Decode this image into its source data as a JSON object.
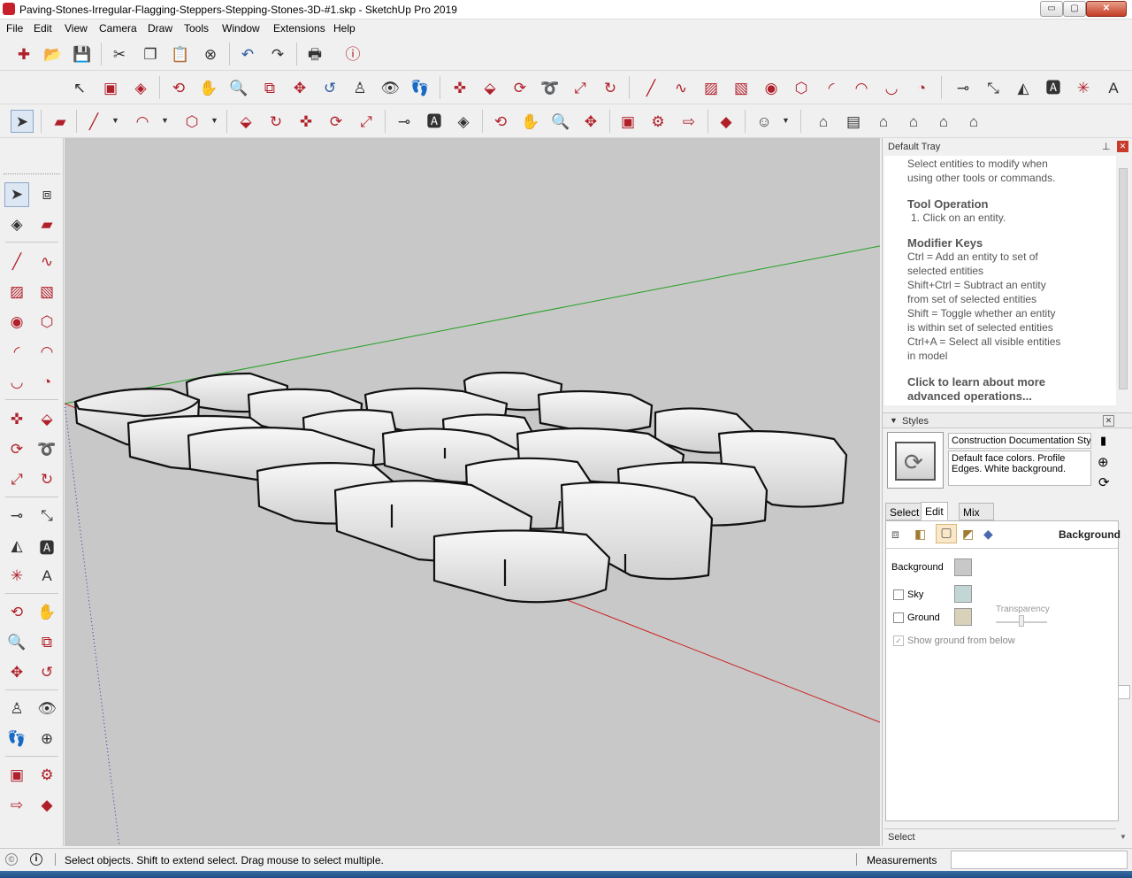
{
  "window": {
    "title": "Paving-Stones-Irregular-Flagging-Steppers-Stepping-Stones-3D-#1.skp - SketchUp Pro 2019",
    "minimize": "▭",
    "maximize": "▢",
    "close": "✕"
  },
  "menu": [
    "File",
    "Edit",
    "View",
    "Camera",
    "Draw",
    "Tools",
    "Window",
    "Extensions",
    "Help"
  ],
  "tray": {
    "title": "Default Tray",
    "pin": "⊥",
    "close": "✕",
    "instructor": {
      "intro_1": "Select entities to modify when",
      "intro_2": "using other tools or commands.",
      "tool_op_header": "Tool Operation",
      "tool_op_1": "1. Click on an entity.",
      "modifier_header": "Modifier Keys",
      "mod_lines": [
        "Ctrl = Add an entity to set of",
        "selected entities",
        "Shift+Ctrl = Subtract an entity",
        "from set of selected entities",
        "Shift = Toggle whether an entity",
        "is within set of selected entities",
        "Ctrl+A = Select all visible entities",
        "in model"
      ],
      "learn_1": "Click to learn about more",
      "learn_2": "advanced operations..."
    },
    "styles": {
      "header": "Styles",
      "arrow": "▼",
      "style_name": "Construction Documentation Sty",
      "style_desc_1": "Default face colors. Profile",
      "style_desc_2": "Edges. White background.",
      "tabs": [
        "Select",
        "Edit",
        "Mix"
      ],
      "active_tab": "Edit",
      "edit_section": "Background",
      "background_label": "Background",
      "sky_label": "Sky",
      "ground_label": "Ground",
      "transparency_label": "Transparency",
      "show_ground_label": "Show ground from below",
      "background_color": "#c8c8c8",
      "sky_color": "#c2d6d6",
      "ground_color": "#d8d2bb"
    },
    "bottom_label": "Select"
  },
  "status": {
    "message": "Select objects. Shift to extend select. Drag mouse to select multiple.",
    "measurements_label": "Measurements",
    "measurements_value": ""
  },
  "icons": {
    "tb1": [
      "new-model-icon",
      "open-icon",
      "save-icon",
      "cut-icon",
      "copy-icon",
      "paste-icon",
      "erase-icon",
      "undo-icon",
      "redo-icon",
      "print-icon",
      "model-info-icon"
    ],
    "tb3_select": "select-arrow-icon"
  },
  "colors": {
    "viewport_bg": "#c8c8c8",
    "axis_red": "#cc2222",
    "axis_green": "#22a022",
    "axis_blue": "#2233aa",
    "icon_accent": "#b0202a"
  }
}
